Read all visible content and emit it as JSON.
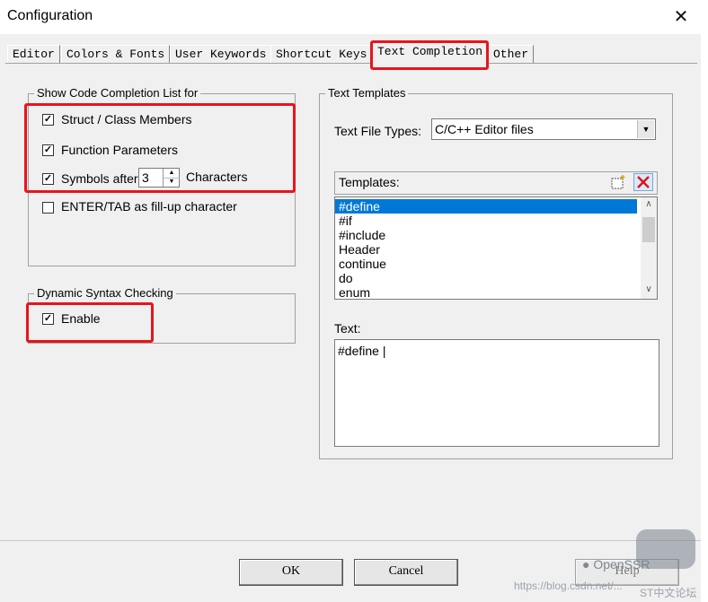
{
  "window": {
    "title": "Configuration",
    "close_glyph": "✕"
  },
  "tabs": [
    {
      "label": "Editor"
    },
    {
      "label": "Colors & Fonts"
    },
    {
      "label": "User Keywords"
    },
    {
      "label": "Shortcut Keys"
    },
    {
      "label": "Text Completion"
    },
    {
      "label": "Other"
    }
  ],
  "completion_group": {
    "title": "Show Code Completion List for",
    "struct_members": {
      "label": "Struct / Class Members",
      "checked": true
    },
    "function_params": {
      "label": "Function Parameters",
      "checked": true
    },
    "symbols_after": {
      "label": "Symbols after",
      "value": "3",
      "suffix": "Characters",
      "checked": true
    },
    "enter_tab": {
      "label": "ENTER/TAB as fill-up character",
      "checked": false
    }
  },
  "syntax_group": {
    "title": "Dynamic Syntax Checking",
    "enable": {
      "label": "Enable",
      "checked": true
    }
  },
  "templates_group": {
    "title": "Text Templates",
    "file_types_label": "Text File Types:",
    "file_types_value": "C/C++ Editor files",
    "templates_label": "Templates:",
    "templates": [
      "#define",
      "#if",
      "#include",
      "Header",
      "continue",
      "do",
      "enum"
    ],
    "selected_index": 0,
    "text_label": "Text:",
    "text_value": "#define |"
  },
  "buttons": {
    "ok": "OK",
    "cancel": "Cancel",
    "help": "Help"
  },
  "watermark": {
    "blog": "https://blog.csdn.net/...",
    "brand": "OpenSSR",
    "sub": "ST中文论坛"
  },
  "colors": {
    "highlight": "#e8141c",
    "selection": "#0078d7"
  }
}
